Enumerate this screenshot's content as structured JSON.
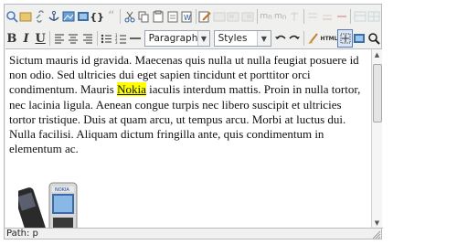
{
  "toolbar1": {
    "buttons": [
      {
        "name": "find-icon",
        "glyph": "🔍"
      },
      {
        "name": "spellcheck-icon",
        "glyph": "⌕"
      },
      {
        "name": "link-icon",
        "glyph": "🔗"
      },
      {
        "name": "anchor-icon",
        "glyph": "⚓"
      },
      {
        "name": "image-icon",
        "glyph": "▭"
      },
      {
        "name": "media-icon",
        "glyph": "▣"
      },
      {
        "name": "code-icon",
        "glyph": "{}"
      },
      {
        "name": "blockquote-icon",
        "glyph": "❝"
      },
      {
        "name": "cut-icon",
        "glyph": "✂"
      },
      {
        "name": "copy-icon",
        "glyph": "⎘"
      },
      {
        "name": "paste-icon",
        "glyph": "📋"
      },
      {
        "name": "paste-text-icon",
        "glyph": "📄"
      },
      {
        "name": "paste-word-icon",
        "glyph": "W"
      },
      {
        "name": "edit-table-icon",
        "glyph": "✎"
      },
      {
        "name": "table-row-icon",
        "glyph": "☰"
      },
      {
        "name": "table-col-icon",
        "glyph": "▥"
      },
      {
        "name": "table-cell-icon",
        "glyph": "▦"
      },
      {
        "name": "merge-cells-icon",
        "glyph": "⊞"
      },
      {
        "name": "split-cells-icon",
        "glyph": "⊟"
      },
      {
        "name": "delete-table-icon",
        "glyph": "⊠"
      },
      {
        "name": "insert-row-icon",
        "glyph": "⇉"
      },
      {
        "name": "delete-row-icon",
        "glyph": "⇇"
      },
      {
        "name": "table-props-icon",
        "glyph": "▤"
      },
      {
        "name": "table-icon",
        "glyph": "▦"
      }
    ]
  },
  "toolbar2": {
    "bold_label": "B",
    "italic_label": "I",
    "underline_label": "U",
    "format_select": "Paragraph",
    "styles_select": "Styles",
    "html_label": "HTML"
  },
  "content": {
    "text_before": "Sictum mauris id gravida. Maecenas quis nulla ut nulla feugiat posuere id non odio. Sed ultricies dui eget sapien tincidunt et porttitor orci condimentum. Mauris ",
    "highlight": "Nokia",
    "text_after": " iaculis interdum mattis. Proin in nulla tortor, nec lacinia ligula. Aenean congue turpis nec libero suscipit et ultricies tortor tristique. Duis at quam arcu, ut tempus arcu. Morbi at luctus dui. Nulla facilisi. Aliquam dictum fringilla ante, quis condimentum in elementum ac.",
    "phone_brand": "NOKIA"
  },
  "status": {
    "path_label": "Path:",
    "path_value": "p"
  },
  "colors": {
    "highlight": "#ffff00",
    "toolbar_bg": "#f0f0ee",
    "border": "#b6bcc6"
  }
}
